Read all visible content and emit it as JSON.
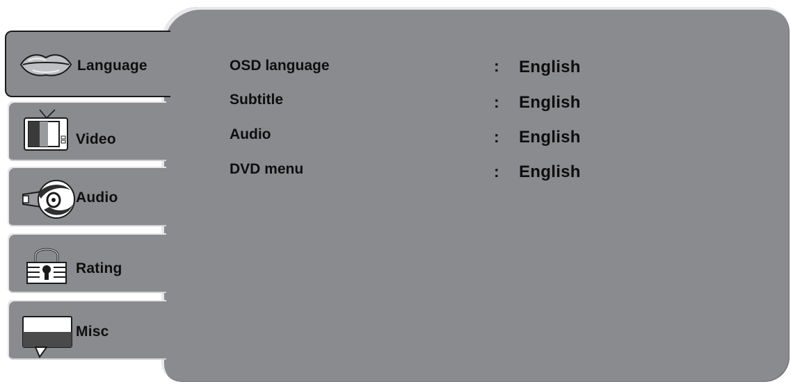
{
  "sidebar": {
    "tabs": [
      {
        "label": "Language",
        "icon": "lips-icon",
        "active": true
      },
      {
        "label": "Video",
        "icon": "tv-icon",
        "active": false
      },
      {
        "label": "Audio",
        "icon": "speaker-icon",
        "active": false
      },
      {
        "label": "Rating",
        "icon": "lock-icon",
        "active": false
      },
      {
        "label": "Misc",
        "icon": "speech-bubble-icon",
        "active": false
      }
    ]
  },
  "settings": {
    "rows": [
      {
        "label": "OSD language",
        "separator": ":",
        "value": "English"
      },
      {
        "label": "Subtitle",
        "separator": ":",
        "value": "English"
      },
      {
        "label": "Audio",
        "separator": ":",
        "value": "English"
      },
      {
        "label": "DVD menu",
        "separator": ":",
        "value": "English"
      }
    ]
  },
  "colors": {
    "panel": "#8a8b8f",
    "text": "#0e0e0e",
    "highlight": "#e6e6e6"
  }
}
